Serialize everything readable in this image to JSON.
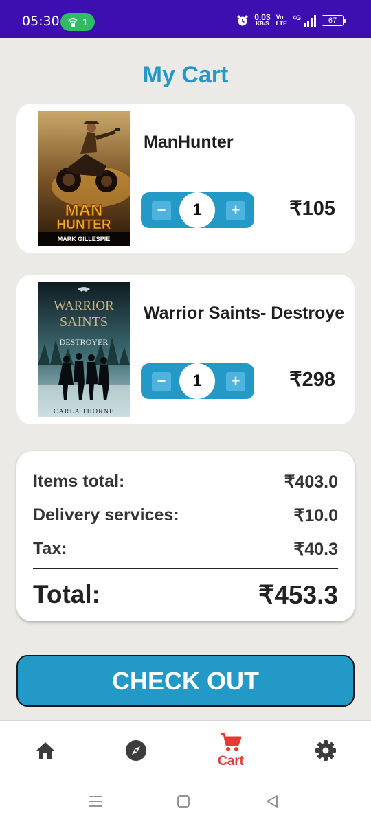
{
  "status_bar": {
    "time": "05:30",
    "hotspot_count": "1",
    "net_speed_value": "0.03",
    "net_speed_unit": "KB/S",
    "volte_top": "Vo",
    "volte_bottom": "LTE",
    "network_type": "4G",
    "battery": "67"
  },
  "page": {
    "title": "My Cart"
  },
  "cart": {
    "items": [
      {
        "title": "ManHunter",
        "cover_title_line1": "MAN",
        "cover_title_line2": "HUNTER",
        "cover_author": "MARK GILLESPIE",
        "quantity": "1",
        "price": "₹105"
      },
      {
        "title": "Warrior Saints- Destroye",
        "cover_title_line1": "WARRIOR",
        "cover_title_line2": "SAINTS",
        "cover_subtitle": "DESTROYER",
        "cover_author": "CARLA THORNE",
        "quantity": "1",
        "price": "₹298"
      }
    ],
    "minus_symbol": "−",
    "plus_symbol": "+"
  },
  "summary": {
    "items_total_label": "Items total:",
    "items_total_value": "₹403.0",
    "delivery_label": "Delivery services:",
    "delivery_value": "₹10.0",
    "tax_label": "Tax:",
    "tax_value": "₹40.3",
    "total_label": "Total:",
    "total_value": "₹453.3"
  },
  "checkout": {
    "label": "CHECK OUT"
  },
  "bottom_nav": {
    "items": [
      {
        "icon": "home-icon",
        "label": ""
      },
      {
        "icon": "compass-icon",
        "label": ""
      },
      {
        "icon": "cart-icon",
        "label": "Cart"
      },
      {
        "icon": "gear-icon",
        "label": ""
      }
    ],
    "active_color": "#e43a36",
    "inactive_color": "#3c3c3c"
  },
  "colors": {
    "accent": "#2399c7",
    "status_bar": "#3d0fb0",
    "background": "#ebeae6"
  }
}
